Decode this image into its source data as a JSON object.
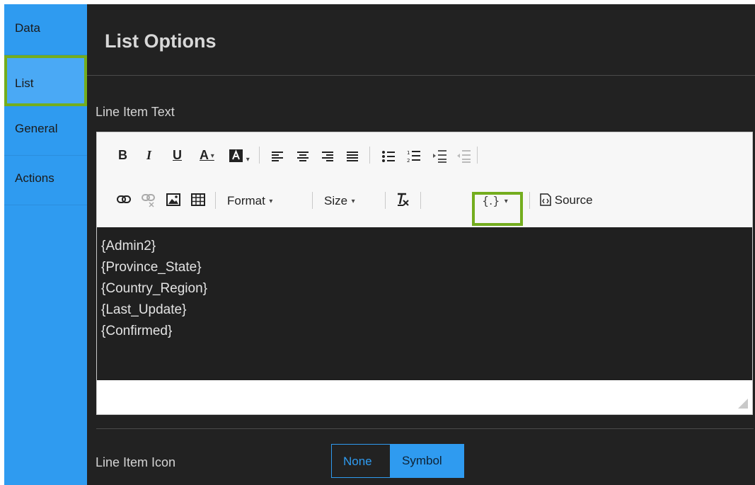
{
  "sidebar": {
    "items": [
      {
        "label": "Data"
      },
      {
        "label": "List"
      },
      {
        "label": "General"
      },
      {
        "label": "Actions"
      }
    ]
  },
  "panel": {
    "title": "List Options",
    "line_item_text_label": "Line Item Text",
    "line_item_icon_label": "Line Item Icon"
  },
  "toolbar": {
    "bold": "B",
    "italic": "I",
    "underline": "U",
    "text_color": "A",
    "format": "Format",
    "size": "Size",
    "source": "Source",
    "variables": "{.}"
  },
  "editor": {
    "lines": [
      "{Admin2}",
      "{Province_State}",
      "{Country_Region}",
      "{Last_Update}",
      "{Confirmed}"
    ]
  },
  "icon_options": {
    "none": "None",
    "symbol": "Symbol"
  },
  "colors": {
    "accent_blue": "#2f9bf0",
    "highlight_green": "#74ad1e",
    "panel_dark": "#222222"
  }
}
